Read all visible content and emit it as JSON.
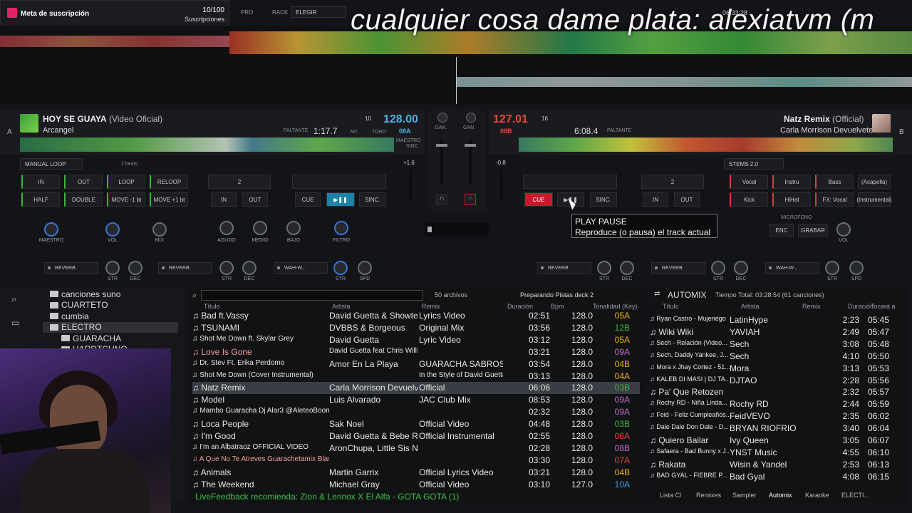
{
  "subscription": {
    "title": "Meta de suscripción",
    "count": "10/100",
    "label": "Suscripciones",
    "progress": 0.1
  },
  "overlay_text": "cualquier cosa dame plata: alexiatvm (m",
  "top_controls": {
    "rack_label": "RACK",
    "rack_value": "ELEGIR",
    "clock": "06:33:28"
  },
  "deck_left": {
    "letter": "A",
    "title": "HOY SE GUAYA",
    "title_suffix": "(Video Oficial)",
    "artist": "Arcangel",
    "remaining_label": "FALTANTE",
    "time": "1:17.7",
    "bpm": "128.00",
    "key": "08A",
    "pitch": "10",
    "mt_label": "MT",
    "toro_label": "TORO",
    "maestro_label": "MAESTRO",
    "sinc_label": "SINC",
    "loop_mode": "MANUAL LOOP",
    "loop_beats": "2 beats",
    "buttons": {
      "in": "IN",
      "out": "OUT",
      "loop": "LOOP",
      "reloop": "RELOOP",
      "half": "HALF",
      "double": "DOUBLE",
      "move_back": "MOVE -1 bt",
      "move_fwd": "MOVE +1 bt"
    },
    "loop_value": "2",
    "cue": "CUE",
    "sinc": "SINC.",
    "in2": "IN",
    "out2": "OUT",
    "pitch_value": "+1.6",
    "knobs": [
      "MAESTRO",
      "VOL",
      "MIX",
      "AGUDO",
      "MEDIO",
      "BAJO",
      "FILTRO"
    ],
    "fx": [
      {
        "name": "REVERB",
        "k1": "STR",
        "k2": "DEC"
      },
      {
        "name": "REVERB",
        "k1": "STR",
        "k2": "DEC"
      },
      {
        "name": "WAH-W...",
        "k1": "STR",
        "k2": "SPD"
      }
    ]
  },
  "deck_right": {
    "letter": "B",
    "title": "Natz Remix",
    "title_suffix": "(Official)",
    "artist": "Carla Morrison Devuelvete",
    "remaining_label": "FALTANTE",
    "time": "6:08.4",
    "bpm": "127.01",
    "key": "08B",
    "pitch": "16",
    "stems": "STEMS 2.0",
    "stem_buttons": [
      "Vocal",
      "Instru",
      "Bass",
      "(Acapella)",
      "Kick",
      "HiHat",
      "FX: Vocal",
      "(Instrumental)"
    ],
    "loop_value": "2",
    "cue": "CUE",
    "sinc": "SINC.",
    "in2": "IN",
    "out2": "OUT",
    "pitch_value": "-0.8",
    "microfono": "MICROFONO",
    "enc": "ENC",
    "grabar": "GRABAR",
    "vol": "VOL",
    "fx": [
      {
        "name": "REVERB",
        "k1": "STR",
        "k2": "DEC"
      },
      {
        "name": "REVERB",
        "k1": "STR",
        "k2": "DEC"
      },
      {
        "name": "WAH-W...",
        "k1": "STR",
        "k2": "SPD"
      }
    ]
  },
  "mixer": {
    "gan_left": "GAN.",
    "gan_right": "GAN."
  },
  "tooltip": {
    "title": "PLAY PAUSE",
    "body": "Reproduce (o pausa) el track actual"
  },
  "tree": [
    {
      "label": "canciones suno",
      "indent": 1
    },
    {
      "label": "CUARTETO",
      "indent": 1
    },
    {
      "label": "cumbia",
      "indent": 1
    },
    {
      "label": "ELECTRO",
      "indent": 1,
      "selected": true
    },
    {
      "label": "GUARACHA",
      "indent": 2
    },
    {
      "label": "HARDTCHNO",
      "indent": 2
    }
  ],
  "browser": {
    "files": "50 archivos",
    "status": "Preparando Pistas deck 2",
    "headers": [
      "Título",
      "Artista",
      "Remix",
      "Duración",
      "Bpm",
      "Tonalidad (Key)"
    ],
    "rows": [
      {
        "title": "Bad ft.Vassy",
        "artist": "David Guetta & Showtek",
        "remix": "Lyrics Video",
        "dur": "02:51",
        "bpm": "128.0",
        "key": "05A",
        "kc": "key"
      },
      {
        "title": "TSUNAMI",
        "artist": "DVBBS & Borgeous",
        "remix": "Original Mix",
        "dur": "03:56",
        "bpm": "128.0",
        "key": "12B",
        "kc": "k-g"
      },
      {
        "title": "Shot Me Down ft. Skylar Grey",
        "artist": "David Guetta",
        "remix": "Lyric Video",
        "dur": "03:12",
        "bpm": "128.0",
        "key": "05A",
        "kc": "key"
      },
      {
        "title": "Love Is Gone",
        "artist": "David Guetta feat Chris Willis",
        "remix": "",
        "dur": "03:21",
        "bpm": "128.0",
        "key": "09A",
        "kc": "k-p",
        "red": true
      },
      {
        "title": "Dr. Stev Ft. Erika Perdomo",
        "artist": "Amor En La Playa",
        "remix": "GUARACHA SABROSONA",
        "dur": "03:54",
        "bpm": "128.0",
        "key": "04B",
        "kc": "key"
      },
      {
        "title": "Shot Me Down (Cover Instrumental)",
        "artist": "",
        "remix": "In the Style of David Guetta &...",
        "dur": "03:13",
        "bpm": "128.0",
        "key": "04A",
        "kc": "key"
      },
      {
        "title": "Natz Remix",
        "artist": "Carla Morrison Devuelvete",
        "remix": "Official",
        "dur": "06:06",
        "bpm": "128.0",
        "key": "03B",
        "kc": "k-g",
        "sel": true
      },
      {
        "title": "Model",
        "artist": "Luis Alvarado",
        "remix": "JAC Club Mix",
        "dur": "08:53",
        "bpm": "128.0",
        "key": "09A",
        "kc": "k-p"
      },
      {
        "title": "Mambo Guaracha Dj Alar3 @AleteoBoom Guar...",
        "artist": "",
        "remix": "",
        "dur": "02:32",
        "bpm": "128.0",
        "key": "09A",
        "kc": "k-p"
      },
      {
        "title": "Loca People",
        "artist": "Sak Noel",
        "remix": "Official Video",
        "dur": "04:48",
        "bpm": "128.0",
        "key": "03B",
        "kc": "k-g"
      },
      {
        "title": "I'm Good",
        "artist": "David Guetta & Bebe Rexha",
        "remix": "Official Instrumental",
        "dur": "02:55",
        "bpm": "128.0",
        "key": "06A",
        "kc": "k-r"
      },
      {
        "title": "I'm an Albatraoz OFFICIAL VIDEO",
        "artist": "AronChupa, Little Sis Nora",
        "remix": "",
        "dur": "02:28",
        "bpm": "128.0",
        "key": "08B",
        "kc": "k-p"
      },
      {
        "title": "A Que No Te Atreves Guarachetamix Blaster Dj",
        "artist": "",
        "remix": "",
        "dur": "03:30",
        "bpm": "128.0",
        "key": "07A",
        "kc": "k-r",
        "red": true
      },
      {
        "title": "Animals",
        "artist": "Martin Garrix",
        "remix": "Official Lyrics Video",
        "dur": "03:21",
        "bpm": "128.0",
        "key": "04B",
        "kc": "key"
      },
      {
        "title": "The Weekend",
        "artist": "Michael Gray",
        "remix": "Official Video",
        "dur": "03:10",
        "bpm": "127.0",
        "key": "10A",
        "kc": "k-b"
      }
    ],
    "footer": "LiveFeedback recomienda: Zion & Lennox X El Alfa - GOTA GOTA (1)"
  },
  "automix": {
    "title": "AUTOMIX",
    "total": "Tiempo Total: 03:28:54 (61 canciones)",
    "headers": [
      "Título",
      "Artista",
      "Remix",
      "Duración",
      "Tocará a"
    ],
    "rows": [
      {
        "title": "Ryan Castro - Mujeriego",
        "artist": "LatinHype",
        "dur": "2:23",
        "at": "05:45"
      },
      {
        "title": "Wiki Wiki",
        "artist": "YAVIAH",
        "dur": "2:49",
        "at": "05:47"
      },
      {
        "title": "Sech - Relación (Video...",
        "artist": "Sech",
        "dur": "3:08",
        "at": "05:48"
      },
      {
        "title": "Sech, Daddy Yankee, J...",
        "artist": "Sech",
        "dur": "4:10",
        "at": "05:50"
      },
      {
        "title": "Mora x Jhay Cortez - 51...",
        "artist": "Mora",
        "dur": "3:13",
        "at": "05:53"
      },
      {
        "title": "KALEB DI MASI | DJ TA...",
        "artist": "DJTAO",
        "dur": "2:28",
        "at": "05:56"
      },
      {
        "title": "Pa' Que Retozen",
        "artist": "",
        "dur": "2:32",
        "at": "05:57"
      },
      {
        "title": "Rochy RD - Niña Linda...",
        "artist": "Rochy RD",
        "dur": "2:44",
        "at": "05:59"
      },
      {
        "title": "Feid - Feliz Cumpleaños...",
        "artist": "FeidVEVO",
        "dur": "2:35",
        "at": "06:02"
      },
      {
        "title": "Dale Dale Don Dale - D...",
        "artist": "BRYAN RIOFRIO",
        "dur": "3:40",
        "at": "06:04"
      },
      {
        "title": "Quiero Bailar",
        "artist": "Ivy Queen",
        "dur": "3:05",
        "at": "06:07"
      },
      {
        "title": "Safaera - Bad Bunny x J...",
        "artist": "YNST Music",
        "dur": "4:55",
        "at": "06:10"
      },
      {
        "title": "Rakata",
        "artist": "Wisin & Yandel",
        "dur": "2:53",
        "at": "06:13"
      },
      {
        "title": "BAD GYAL - FIEBRE P...",
        "artist": "Bad Gyal",
        "dur": "4:08",
        "at": "06:15"
      }
    ],
    "tabs": [
      "Lista Cl",
      "Remixes",
      "Sampler",
      "Automix",
      "Karaoke",
      "ELECTI..."
    ]
  },
  "colors": {
    "accent": "#1e82a4",
    "cue_red": "#c01d2a",
    "bpm_left": "#4ab3e0",
    "bpm_right": "#e24a3a",
    "key": "#f0b01e",
    "loop_green": "#3db33d",
    "sub_fill": "#e0246a"
  },
  "icons": [
    "search-icon",
    "folder-icon",
    "note-icon",
    "play-icon",
    "pause-icon",
    "headphones-icon",
    "gear-icon"
  ]
}
